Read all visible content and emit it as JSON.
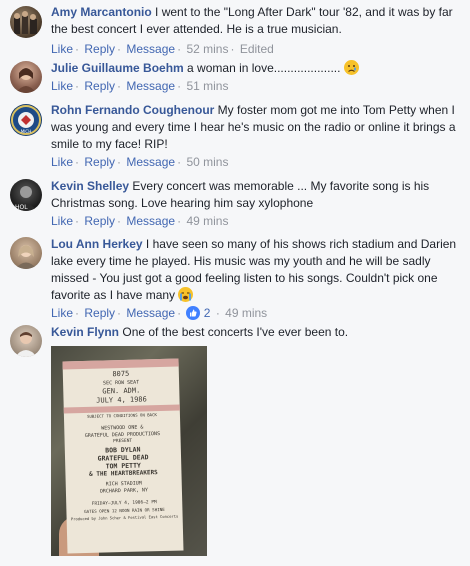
{
  "comments": [
    {
      "name": "Amy Marcantonio",
      "text": "I went to the \"Long After Dark\" tour '82, and it was by far the best concert I ever attended. He is a true musician.",
      "actions": [
        "Like",
        "Reply",
        "Message"
      ],
      "time": "52 mins",
      "edited": "Edited"
    },
    {
      "name": "Julie Guillaume Boehm",
      "text": "a woman in love....................",
      "actions": [
        "Like",
        "Reply",
        "Message"
      ],
      "time": "51 mins"
    },
    {
      "name": "Rohn Fernando Coughenour",
      "text": "My foster mom got me into Tom Petty when I was young and every time I hear he's music on the radio or online it brings a smile to my face! RIP!",
      "actions": [
        "Like",
        "Reply",
        "Message"
      ],
      "time": "50 mins"
    },
    {
      "name": "Kevin Shelley",
      "text": "Every concert was memorable ... My favorite song is his Christmas song. Love hearing him say xylophone",
      "actions": [
        "Like",
        "Reply",
        "Message"
      ],
      "time": "49 mins"
    },
    {
      "name": "Lou Ann Herkey",
      "text": "I have seen so many of his shows rich stadium and Darien lake every time he played. His music was my youth and he will be sadly missed - You just got a good feeling listen to his songs. Couldn't pick one favorite as I have many",
      "actions": [
        "Like",
        "Reply",
        "Message"
      ],
      "reactions": "2",
      "time": "49 mins"
    },
    {
      "name": "Kevin Flynn",
      "text": "One of the best concerts I've ever been to."
    }
  ],
  "ticket": {
    "number": "8075",
    "row": "SEC ROW SEAT",
    "admission": "GEN. ADM.",
    "date": "JULY 4, 1986",
    "small": "SUBJECT TO CONDITIONS ON BACK",
    "promoter1": "WESTWOOD ONE &",
    "promoter2": "GRATEFUL DEAD PRODUCTIONS",
    "present": "PRESENT",
    "act1": "BOB DYLAN",
    "act2": "GRATEFUL DEAD",
    "act3": "TOM PETTY",
    "act4": "& THE HEARTBREAKERS",
    "venue1": "RICH STADIUM",
    "venue2": "ORCHARD PARK, NY",
    "time": "FRIDAY—JULY 4, 1986—2 PM",
    "gates": "GATES OPEN 12 NOON RAIN OR SHINE",
    "produced": "Produced by John Scher & Festival East Concerts"
  },
  "colors": {
    "name": "#385898",
    "link": "#4267b2",
    "meta": "#90949c",
    "background": "#f6f7f9"
  }
}
